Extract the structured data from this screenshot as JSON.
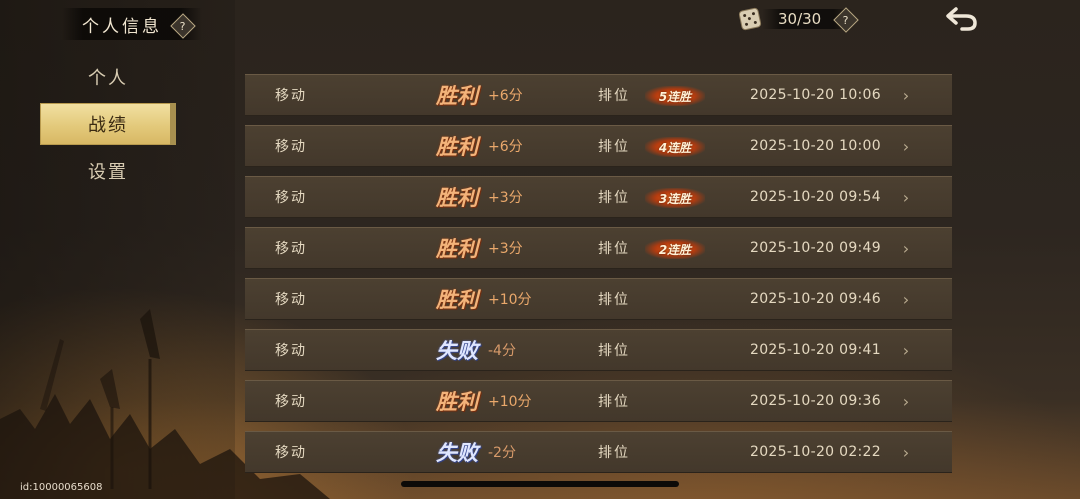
{
  "header": {
    "title": "个人信息",
    "help_symbol": "?",
    "stamina": "30/30",
    "stamina_help_symbol": "?"
  },
  "sidebar": {
    "items": [
      {
        "label": "个人",
        "active": false
      },
      {
        "label": "战绩",
        "active": true
      },
      {
        "label": "设置",
        "active": false
      }
    ]
  },
  "records": [
    {
      "mode": "移动",
      "result": "胜利",
      "outcome": "win",
      "score": "+6分",
      "match_type": "排位",
      "streak": "5连胜",
      "datetime": "2025-10-20 10:06"
    },
    {
      "mode": "移动",
      "result": "胜利",
      "outcome": "win",
      "score": "+6分",
      "match_type": "排位",
      "streak": "4连胜",
      "datetime": "2025-10-20 10:00"
    },
    {
      "mode": "移动",
      "result": "胜利",
      "outcome": "win",
      "score": "+3分",
      "match_type": "排位",
      "streak": "3连胜",
      "datetime": "2025-10-20 09:54"
    },
    {
      "mode": "移动",
      "result": "胜利",
      "outcome": "win",
      "score": "+3分",
      "match_type": "排位",
      "streak": "2连胜",
      "datetime": "2025-10-20 09:49"
    },
    {
      "mode": "移动",
      "result": "胜利",
      "outcome": "win",
      "score": "+10分",
      "match_type": "排位",
      "streak": "",
      "datetime": "2025-10-20 09:46"
    },
    {
      "mode": "移动",
      "result": "失败",
      "outcome": "lose",
      "score": "-4分",
      "match_type": "排位",
      "streak": "",
      "datetime": "2025-10-20 09:41"
    },
    {
      "mode": "移动",
      "result": "胜利",
      "outcome": "win",
      "score": "+10分",
      "match_type": "排位",
      "streak": "",
      "datetime": "2025-10-20 09:36"
    },
    {
      "mode": "移动",
      "result": "失败",
      "outcome": "lose",
      "score": "-2分",
      "match_type": "排位",
      "streak": "",
      "datetime": "2025-10-20 02:22"
    }
  ],
  "footer": {
    "user_id": "id:10000065608"
  },
  "colors": {
    "accent_gold": "#e3c97b",
    "win_orange": "#f3b37a",
    "lose_blue": "#dfe6ff",
    "streak_red": "#e46a1e"
  },
  "icons": {
    "back": "back-arrow-icon",
    "stamina": "dice-icon",
    "row_detail": "chevron-right-icon",
    "help": "help-icon"
  }
}
